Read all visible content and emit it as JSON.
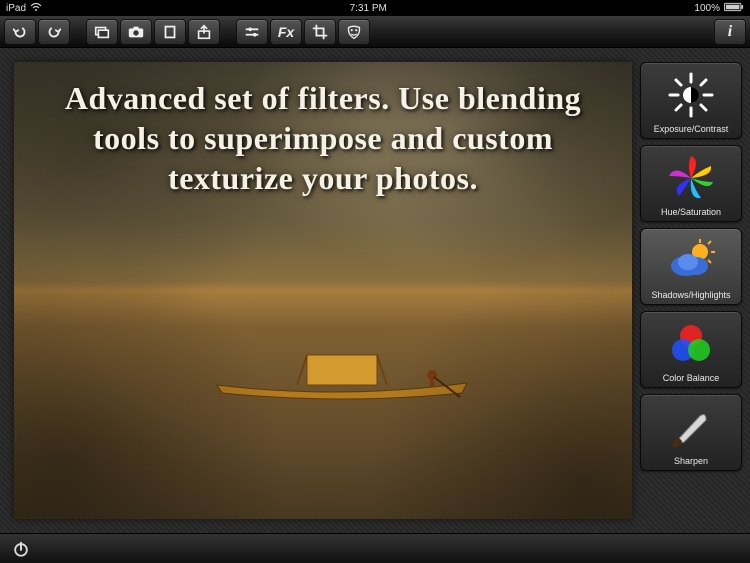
{
  "status": {
    "carrier": "iPad",
    "time": "7:31 PM",
    "battery_pct": "100%"
  },
  "toolbar": {
    "undo_name": "undo-icon",
    "redo_name": "redo-icon",
    "new_name": "new-canvas-icon",
    "camera_name": "camera-icon",
    "frame_name": "aspect-icon",
    "share_name": "share-icon",
    "adjust_name": "sliders-icon",
    "fx_label": "Fx",
    "crop_name": "crop-icon",
    "mask_name": "mask-icon",
    "info_label": "i"
  },
  "canvas": {
    "overlay_text": "Advanced set of filters. Use blending tools to superimpose and custom texturize your photos."
  },
  "filters": [
    {
      "label": "Exposure/Contrast",
      "name": "filter-exposure-contrast",
      "icon": "brightness-icon"
    },
    {
      "label": "Hue/Saturation",
      "name": "filter-hue-saturation",
      "icon": "rainbow-swirl-icon"
    },
    {
      "label": "Shadows/Highlights",
      "name": "filter-shadows-highlights",
      "icon": "cloud-sun-icon"
    },
    {
      "label": "Color Balance",
      "name": "filter-color-balance",
      "icon": "rgb-circles-icon"
    },
    {
      "label": "Sharpen",
      "name": "filter-sharpen",
      "icon": "knife-icon"
    }
  ],
  "selected_filter": 2,
  "bottombar": {
    "power_name": "power-icon"
  }
}
